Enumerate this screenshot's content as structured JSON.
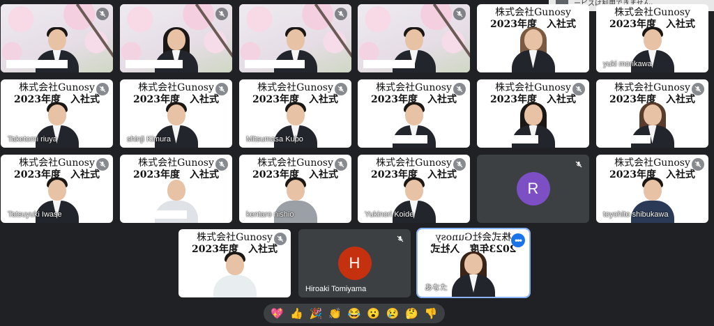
{
  "banner": {
    "text": "ービスは利用できません。"
  },
  "sign": {
    "line1": "株式会社Gunosy",
    "line2": "2023年度　入社式"
  },
  "participants": {
    "p5": "yuki morikawa",
    "p6": "Taketomi riuya",
    "p7": "shinji Kimura",
    "p8": "Mitsumasa Kubo",
    "p12": "Tatsuyuki Iwase",
    "p14": "kentaro nishio",
    "p15": "Yukinori Koide",
    "p16": "R",
    "p17": "toyohito shibukawa",
    "p19": "Hiroaki Tomiyama",
    "p19_initial": "H",
    "p20": "あなた"
  },
  "colors": {
    "avatar_r": "#7d4fc4",
    "avatar_h": "#c5300f",
    "accent": "#1a73e8"
  },
  "reactions": [
    "💖",
    "👍",
    "🎉",
    "👏",
    "😂",
    "😮",
    "😢",
    "🤔",
    "👎"
  ]
}
